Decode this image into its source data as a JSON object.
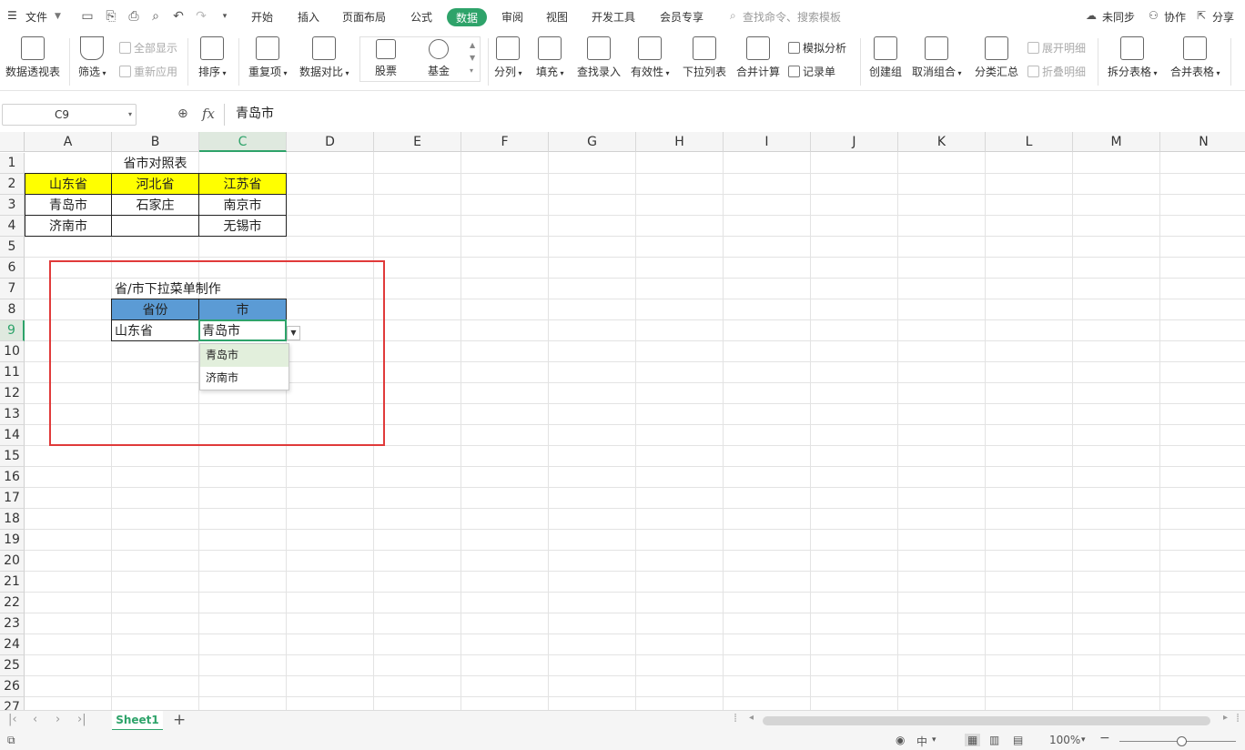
{
  "menubar": {
    "file": "文件",
    "tabs": [
      "开始",
      "插入",
      "页面布局",
      "公式",
      "数据",
      "审阅",
      "视图",
      "开发工具",
      "会员专享"
    ],
    "active_tab": "数据",
    "search_placeholder": "查找命令、搜索模板",
    "unsynced": "未同步",
    "collaborate": "协作",
    "share": "分享"
  },
  "ribbon": {
    "pivot": "数据透视表",
    "filter": "筛选",
    "show_all": "全部显示",
    "reapply": "重新应用",
    "sort": "排序",
    "duplicates": "重复项",
    "compare": "数据对比",
    "stocks": "股票",
    "fund": "基金",
    "split": "分列",
    "fill": "填充",
    "lookup": "查找录入",
    "validity": "有效性",
    "dropdown_list": "下拉列表",
    "consolidate": "合并计算",
    "simulation": "模拟分析",
    "record_form": "记录单",
    "group": "创建组",
    "ungroup": "取消组合",
    "subtotal": "分类汇总",
    "expand_detail": "展开明细",
    "collapse_detail": "折叠明细",
    "split_table": "拆分表格",
    "merge_table": "合并表格"
  },
  "formula_bar": {
    "cell_ref": "C9",
    "fx": "fx",
    "value": "青岛市"
  },
  "grid": {
    "columns": [
      "A",
      "B",
      "C",
      "D",
      "E",
      "F",
      "G",
      "H",
      "I",
      "J",
      "K",
      "L",
      "M",
      "N"
    ],
    "rows": [
      "1",
      "2",
      "3",
      "4",
      "5",
      "6",
      "7",
      "8",
      "9",
      "10",
      "11",
      "12",
      "13",
      "14",
      "15",
      "16",
      "17",
      "18",
      "19",
      "20",
      "21",
      "22",
      "23",
      "24",
      "25",
      "26",
      "27"
    ],
    "selected_column": "C",
    "selected_row": "9",
    "cells": {
      "B1": "省市对照表",
      "A2": "山东省",
      "B2": "河北省",
      "C2": "江苏省",
      "A3": "青岛市",
      "B3": "石家庄",
      "C3": "南京市",
      "A4": "济南市",
      "C4": "无锡市",
      "B7": "省/市下拉菜单制作",
      "B8": "省份",
      "C8": "市",
      "B9": "山东省",
      "C9": "青岛市"
    },
    "header_fill_yellow": "#ffff00",
    "header_fill_blue": "#5b9bd5",
    "highlight_box_color": "#e03a3a"
  },
  "dropdown": {
    "options": [
      "青岛市",
      "济南市"
    ],
    "highlighted": "青岛市"
  },
  "tabs": {
    "sheet": "Sheet1"
  },
  "status": {
    "zoom": "100%",
    "ime": "中"
  }
}
